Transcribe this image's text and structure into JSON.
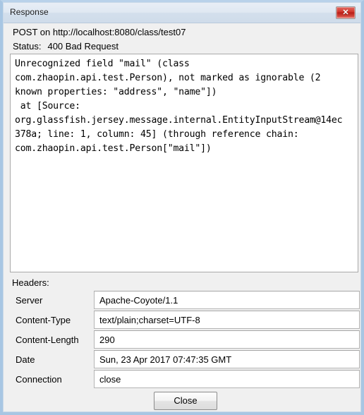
{
  "window": {
    "title": "Response",
    "close_icon": "close-x-icon",
    "close_icon_glyph": "✕",
    "border_color": "#a8c6e3",
    "titlebar_color": "#dfe8f2",
    "close_button_color": "#c42f24"
  },
  "request": {
    "line": "POST on http://localhost:8080/class/test07",
    "status_label": "Status:",
    "status_value": "400 Bad Request"
  },
  "body": {
    "text": "Unrecognized field \"mail\" (class\ncom.zhaopin.api.test.Person), not marked as ignorable (2\nknown properties: \"address\", \"name\"])\n at [Source:\norg.glassfish.jersey.message.internal.EntityInputStream@14ec\n378a; line: 1, column: 45] (through reference chain:\ncom.zhaopin.api.test.Person[\"mail\"])"
  },
  "headers": {
    "label": "Headers:",
    "rows": [
      {
        "name": "Server",
        "value": "Apache-Coyote/1.1"
      },
      {
        "name": "Content-Type",
        "value": "text/plain;charset=UTF-8"
      },
      {
        "name": "Content-Length",
        "value": "290"
      },
      {
        "name": "Date",
        "value": "Sun, 23 Apr 2017 07:47:35 GMT"
      },
      {
        "name": "Connection",
        "value": "close"
      }
    ]
  },
  "footer": {
    "close_label": "Close"
  }
}
